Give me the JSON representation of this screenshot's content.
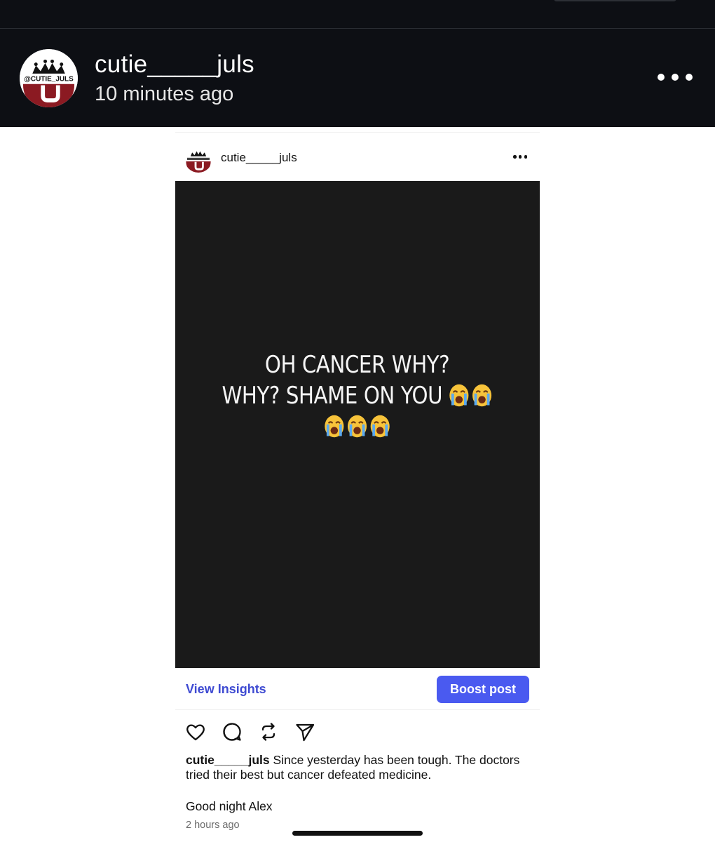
{
  "header": {
    "username": "cutie_____juls",
    "timestamp": "10 minutes ago",
    "avatar_text": "@CUTIE_JULS",
    "more_icon": "more-horizontal-icon"
  },
  "post": {
    "username": "cutie_____juls",
    "image_text": {
      "line1": "OH CANCER WHY?",
      "line2": "WHY? SHAME ON YOU"
    },
    "emojis": [
      "loudly-crying-face",
      "loudly-crying-face",
      "loudly-crying-face",
      "loudly-crying-face",
      "loudly-crying-face"
    ],
    "view_insights_label": "View Insights",
    "boost_label": "Boost post",
    "actions": [
      "heart-icon",
      "comment-icon",
      "repost-icon",
      "share-icon"
    ],
    "caption_username": "cutie_____juls",
    "caption_text": "Since yesterday has been tough. The doctors tried their best but cancer defeated medicine.",
    "caption_text_2": "Good night Alex",
    "timestamp": "2 hours ago"
  },
  "colors": {
    "header_bg": "#0d0f14",
    "image_bg": "#1a1a1a",
    "accent_link": "#3f4bd2",
    "boost_bg": "#4a5af0",
    "avatar_red": "#8b1a22"
  }
}
